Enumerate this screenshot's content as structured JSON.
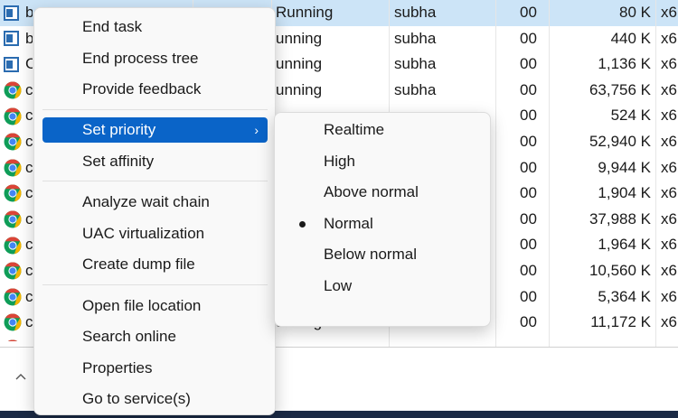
{
  "colors": {
    "menu_highlight": "#0a64c8",
    "row_selected": "#cce4f7",
    "chrome_red": "#db4437",
    "chrome_yellow": "#f4b400",
    "chrome_green": "#0f9d58",
    "chrome_blue": "#4285f4"
  },
  "table": {
    "rows": [
      {
        "icon": "app-window-icon",
        "name": "b",
        "status": "Running",
        "user": "subha",
        "cpu": "00",
        "memory": "80 K",
        "arch": "x6",
        "selected": true
      },
      {
        "icon": "app-window-icon",
        "name": "b",
        "status": "unning",
        "user": "subha",
        "cpu": "00",
        "memory": "440 K",
        "arch": "x6",
        "selected": false
      },
      {
        "icon": "app-window-icon",
        "name": "C",
        "status": "unning",
        "user": "subha",
        "cpu": "00",
        "memory": "1,136 K",
        "arch": "x6",
        "selected": false
      },
      {
        "icon": "chrome-icon",
        "name": "c",
        "status": "unning",
        "user": "subha",
        "cpu": "00",
        "memory": "63,756 K",
        "arch": "x6",
        "selected": false
      },
      {
        "icon": "chrome-icon",
        "name": "c",
        "status": "",
        "user": "",
        "cpu": "00",
        "memory": "524 K",
        "arch": "x6",
        "selected": false
      },
      {
        "icon": "chrome-icon",
        "name": "c",
        "status": "",
        "user": "",
        "cpu": "00",
        "memory": "52,940 K",
        "arch": "x6",
        "selected": false
      },
      {
        "icon": "chrome-icon",
        "name": "c",
        "status": "",
        "user": "",
        "cpu": "00",
        "memory": "9,944 K",
        "arch": "x6",
        "selected": false
      },
      {
        "icon": "chrome-icon",
        "name": "c",
        "status": "",
        "user": "",
        "cpu": "00",
        "memory": "1,904 K",
        "arch": "x6",
        "selected": false
      },
      {
        "icon": "chrome-icon",
        "name": "c",
        "status": "",
        "user": "",
        "cpu": "00",
        "memory": "37,988 K",
        "arch": "x6",
        "selected": false
      },
      {
        "icon": "chrome-icon",
        "name": "c",
        "status": "",
        "user": "",
        "cpu": "00",
        "memory": "1,964 K",
        "arch": "x6",
        "selected": false
      },
      {
        "icon": "chrome-icon",
        "name": "c",
        "status": "",
        "user": "",
        "cpu": "00",
        "memory": "10,560 K",
        "arch": "x6",
        "selected": false
      },
      {
        "icon": "chrome-icon",
        "name": "c",
        "status": "",
        "user": "",
        "cpu": "00",
        "memory": "5,364 K",
        "arch": "x6",
        "selected": false
      },
      {
        "icon": "chrome-icon",
        "name": "c",
        "status": "unning",
        "user": "subha",
        "cpu": "00",
        "memory": "11,172 K",
        "arch": "x6",
        "selected": false
      }
    ]
  },
  "context_menu": {
    "items": [
      {
        "label": "End task"
      },
      {
        "label": "End process tree"
      },
      {
        "label": "Provide feedback"
      },
      {
        "label": "Set priority",
        "active": true,
        "has_submenu": true
      },
      {
        "label": "Set affinity"
      },
      {
        "label": "Analyze wait chain"
      },
      {
        "label": "UAC virtualization"
      },
      {
        "label": "Create dump file"
      },
      {
        "label": "Open file location"
      },
      {
        "label": "Search online"
      },
      {
        "label": "Properties"
      },
      {
        "label": "Go to service(s)"
      }
    ],
    "submenu_arrow": "›"
  },
  "priority_submenu": {
    "items": [
      {
        "label": "Realtime",
        "checked": false
      },
      {
        "label": "High",
        "checked": false
      },
      {
        "label": "Above normal",
        "checked": false
      },
      {
        "label": "Normal",
        "checked": true
      },
      {
        "label": "Below normal",
        "checked": false
      },
      {
        "label": "Low",
        "checked": false
      }
    ]
  }
}
